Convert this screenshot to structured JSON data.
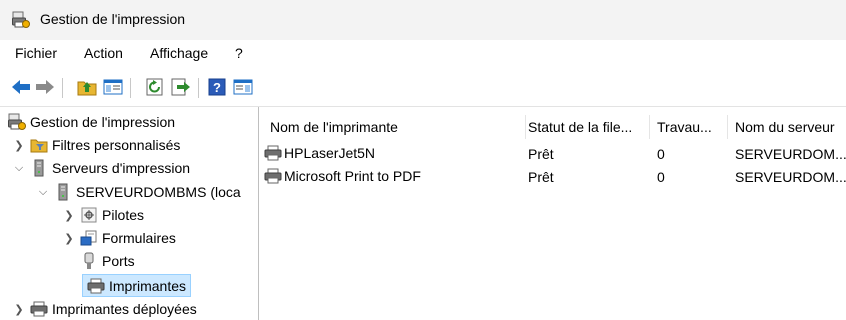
{
  "window": {
    "title": "Gestion de l'impression"
  },
  "menu": [
    "Fichier",
    "Action",
    "Affichage",
    "?"
  ],
  "toolbar": {
    "buttons": [
      "back-arrow-icon",
      "forward-arrow-icon",
      "up-folder-icon",
      "show-hide-console-tree-icon",
      "refresh-icon",
      "export-list-icon",
      "help-icon",
      "show-action-pane-icon"
    ]
  },
  "tree": {
    "root": "Gestion de l'impression",
    "custom_filters": "Filtres personnalisés",
    "print_servers": "Serveurs d'impression",
    "server": "SERVEURDOMBMS (loca",
    "drivers": "Pilotes",
    "forms": "Formulaires",
    "ports": "Ports",
    "printers": "Imprimantes",
    "deployed": "Imprimantes déployées"
  },
  "list": {
    "columns": [
      "Nom de l'imprimante",
      "Statut de la file...",
      "Travau...",
      "Nom du serveur"
    ],
    "rows": [
      {
        "name": "HPLaserJet5N",
        "status": "Prêt",
        "jobs": "0",
        "server": "SERVEURDOM..."
      },
      {
        "name": "Microsoft Print to PDF",
        "status": "Prêt",
        "jobs": "0",
        "server": "SERVEURDOM..."
      }
    ]
  },
  "colors": {
    "selection": "#cce8ff",
    "selection_border": "#99d1ff",
    "titlebar": "#f3f3f3"
  }
}
